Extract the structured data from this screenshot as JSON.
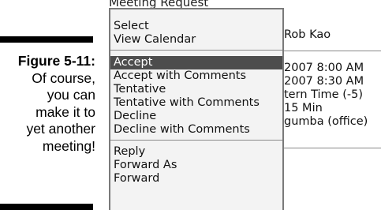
{
  "caption": {
    "figure": "Figure 5-11:",
    "lines": [
      "Of course,",
      "you can",
      "make it to",
      "yet another",
      "meeting!"
    ]
  },
  "screen": {
    "title": "Meeting Request",
    "background_fields": [
      "Rob Kao",
      "2007 8:00 AM",
      "2007 8:30 AM",
      "tern Time (-5)",
      "15 Min",
      "gumba (office)"
    ]
  },
  "menu": {
    "items": [
      {
        "label": "Select"
      },
      {
        "label": "View Calendar"
      },
      {
        "label": "Accept",
        "selected": true
      },
      {
        "label": "Accept with Comments"
      },
      {
        "label": "Tentative"
      },
      {
        "label": "Tentative with Comments"
      },
      {
        "label": "Decline"
      },
      {
        "label": "Decline with Comments"
      },
      {
        "label": "Reply"
      },
      {
        "label": "Forward As"
      },
      {
        "label": "Forward"
      }
    ]
  },
  "colors": {
    "menu_background": "#f3f3f3",
    "highlight": "#4d4d4d",
    "highlight_text": "#ffffff"
  }
}
